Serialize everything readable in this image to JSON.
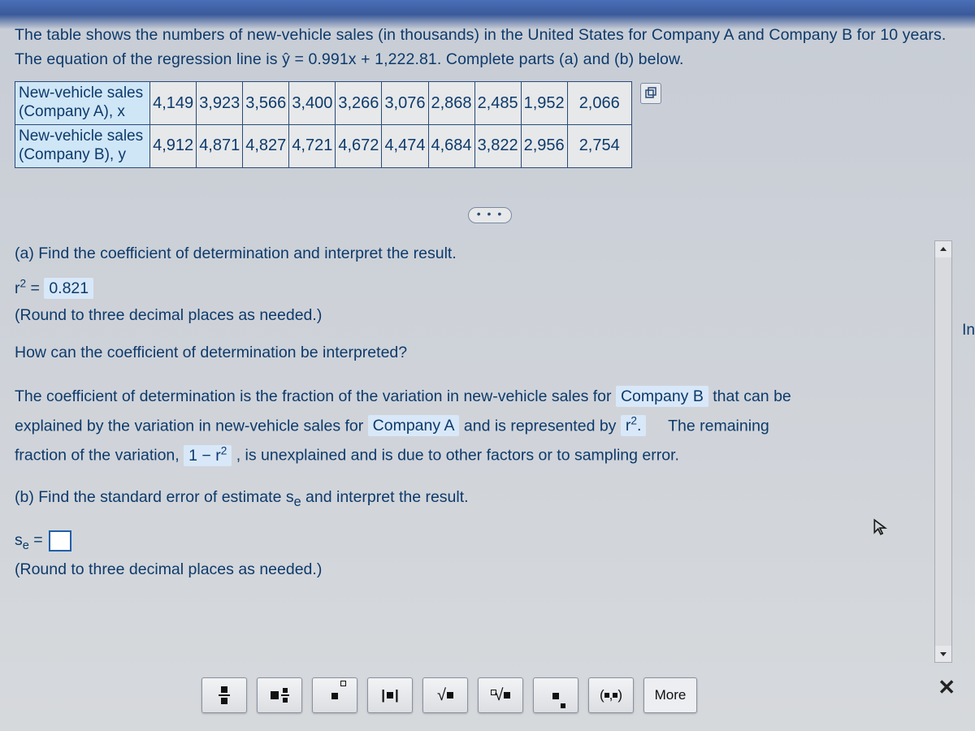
{
  "intro": "The table shows the numbers of new-vehicle sales (in thousands) in the United States for Company A and Company B for 10 years. The equation of the regression line is ŷ = 0.991x + 1,222.81. Complete parts (a) and (b) below.",
  "table": {
    "row_a_label_1": "New-vehicle sales",
    "row_a_label_2": "(Company A), x",
    "row_b_label_1": "New-vehicle sales",
    "row_b_label_2": "(Company B), y",
    "a": [
      "4,149",
      "3,923",
      "3,566",
      "3,400",
      "3,266",
      "3,076",
      "2,868",
      "2,485",
      "1,952",
      "2,066"
    ],
    "b": [
      "4,912",
      "4,871",
      "4,827",
      "4,721",
      "4,672",
      "4,474",
      "4,684",
      "3,822",
      "2,956",
      "2,754"
    ]
  },
  "ellipsis": "• • •",
  "part_a": {
    "prompt": "(a) Find the coefficient of determination and interpret the result.",
    "r2_label": "r² = ",
    "r2_value": "0.821",
    "round_note": "(Round to three decimal places as needed.)",
    "interp_q": "How can the coefficient of determination be interpreted?",
    "sent1_a": "The coefficient of determination is the fraction of the variation in new-vehicle sales for ",
    "drop1": "Company B",
    "sent1_b": " that can be",
    "sent2_a": "explained by the variation in new-vehicle sales for ",
    "drop2": "Company A",
    "sent2_b": " and is represented by ",
    "drop3": "r².",
    "sent2_c": "The remaining",
    "sent3_a": "fraction of the variation, ",
    "drop4": "1 − r²",
    "sent3_b": ", is unexplained and is due to other factors or to sampling error."
  },
  "part_b": {
    "prompt": "(b) Find the standard error of estimate sₑ and interpret the result.",
    "se_label": "sₑ = ",
    "round_note": "(Round to three decimal places as needed.)"
  },
  "toolbar": {
    "more": "More",
    "interval": "(▪,▪)"
  },
  "side_letter": "In",
  "chart_data": {
    "type": "table",
    "title": "New-vehicle sales (thousands), Company A vs Company B, 10 years",
    "columns": [
      "Company A (x)",
      "Company B (y)"
    ],
    "x": [
      4149,
      3923,
      3566,
      3400,
      3266,
      3076,
      2868,
      2485,
      1952,
      2066
    ],
    "y": [
      4912,
      4871,
      4827,
      4721,
      4672,
      4474,
      4684,
      3822,
      2956,
      2754
    ],
    "regression": {
      "slope": 0.991,
      "intercept": 1222.81,
      "equation": "ŷ = 0.991x + 1222.81"
    },
    "r_squared": 0.821
  }
}
